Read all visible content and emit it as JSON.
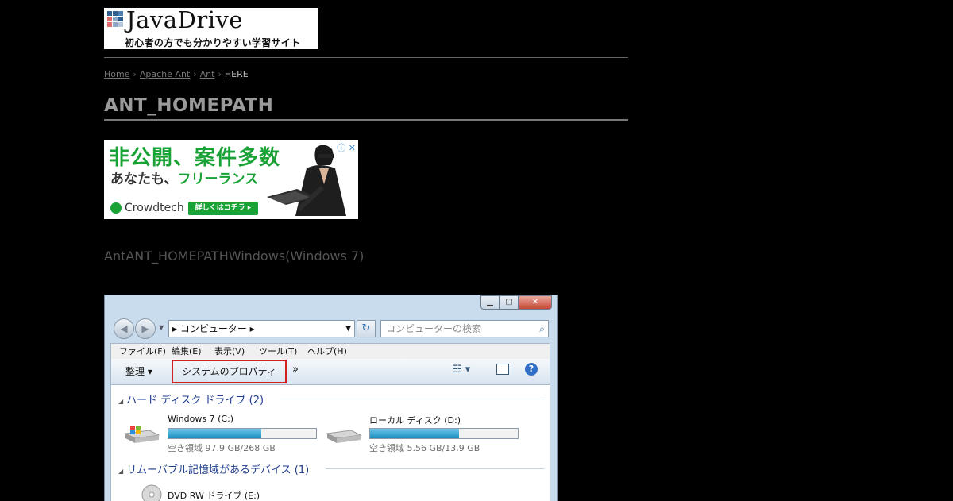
{
  "logo": {
    "title": "JavaDrive",
    "subtitle": "初心者の方でも分かりやすい学習サイト",
    "square_colors": [
      "#2e5f93",
      "#2e5f93",
      "#4b7fb8",
      "#e06b6b",
      "#8aa7c7",
      "#2e5f93",
      "#e06b6b",
      "#8aa7c7",
      "#b3c7dd"
    ]
  },
  "breadcrumb": {
    "items": [
      "Home",
      "Apache Ant",
      "Ant"
    ],
    "current": "HERE",
    "separator": "›"
  },
  "page_title": "ANT_HOMEPATH",
  "ad": {
    "headline": "非公開、案件多数",
    "line2_prefix": "あなたも、",
    "line2_highlight": "フリーランス",
    "brand": "Crowdtech",
    "button": "詳しくはコチラ ▸",
    "info_icons": "ⓘ ✕",
    "accent_color": "#19a236"
  },
  "intro_text": "AntANT_HOMEPATHWindows(Windows 7)",
  "screenshot": {
    "window_buttons": {
      "minimize": "▁",
      "maximize": "▢",
      "close": "✕"
    },
    "address": "▸ コンピューター ▸",
    "search_placeholder": "コンピューターの検索",
    "search_icon": "search-icon",
    "menu": [
      "ファイル(F)",
      "編集(E)",
      "表示(V)",
      "ツール(T)",
      "ヘルプ(H)"
    ],
    "commands": {
      "organize": "整理 ▾",
      "system_properties": "システムのプロパティ",
      "more": "»",
      "view_icon": "☷ ▾",
      "help": "?"
    },
    "groups": [
      {
        "title": "ハード ディスク ドライブ (2)"
      },
      {
        "title": "リムーバブル記憶域があるデバイス (1)"
      }
    ],
    "drives": [
      {
        "name": "Windows 7 (C:)",
        "free_text": "空き領域 97.9 GB/268 GB",
        "used_fraction": 0.63
      },
      {
        "name": "ローカル ディスク (D:)",
        "free_text": "空き領域 5.56 GB/13.9 GB",
        "used_fraction": 0.6
      }
    ],
    "removable": [
      {
        "name": "DVD RW ドライブ (E:)"
      }
    ],
    "highlight_color": "#d21f1f"
  }
}
